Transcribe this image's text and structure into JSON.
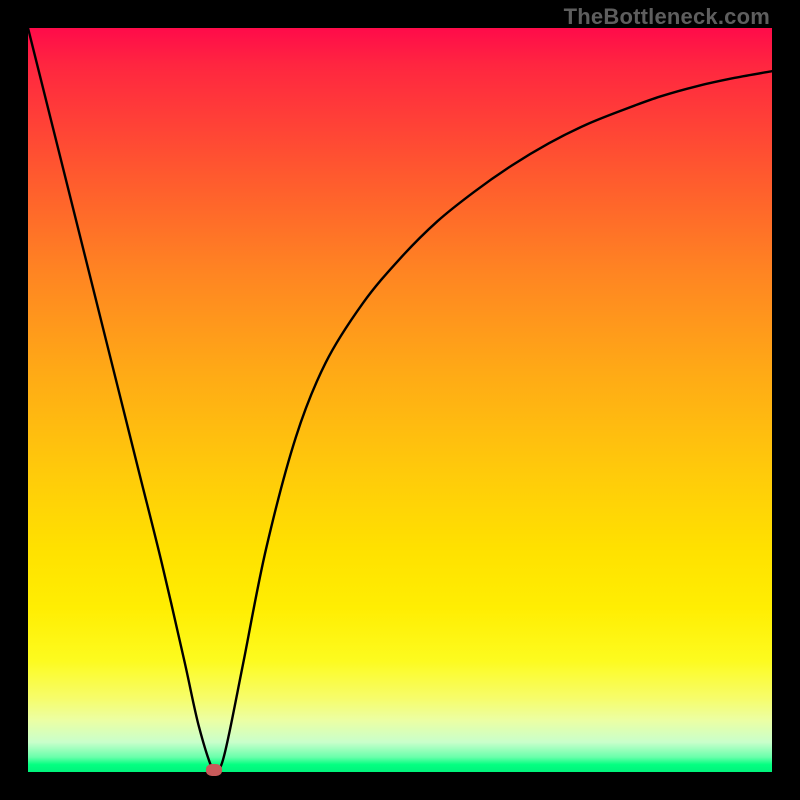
{
  "watermark": "TheBottleneck.com",
  "colors": {
    "background": "#000000",
    "curve": "#000000",
    "marker": "#c85a5a"
  },
  "chart_data": {
    "type": "line",
    "title": "",
    "xlabel": "",
    "ylabel": "",
    "xlim": [
      0,
      100
    ],
    "ylim": [
      0,
      100
    ],
    "grid": false,
    "notes": "Axes unlabeled; V-shaped bottleneck curve with minimum near x≈25. Background is a red→yellow→green vertical gradient (red = high bottleneck, green = low). Marker dot sits at the curve minimum.",
    "series": [
      {
        "name": "bottleneck-curve",
        "x": [
          0,
          3,
          6,
          9,
          12,
          15,
          18,
          21,
          23,
          25,
          26,
          27,
          29,
          32,
          36,
          40,
          45,
          50,
          55,
          60,
          65,
          70,
          75,
          80,
          85,
          90,
          95,
          100
        ],
        "values": [
          100,
          88,
          76,
          64,
          52,
          40,
          28,
          15,
          6,
          0,
          1,
          5,
          15,
          30,
          45,
          55,
          63,
          69,
          74,
          78,
          81.5,
          84.5,
          87,
          89,
          90.8,
          92.2,
          93.3,
          94.2
        ]
      }
    ],
    "marker": {
      "x": 25,
      "y": 0
    }
  }
}
